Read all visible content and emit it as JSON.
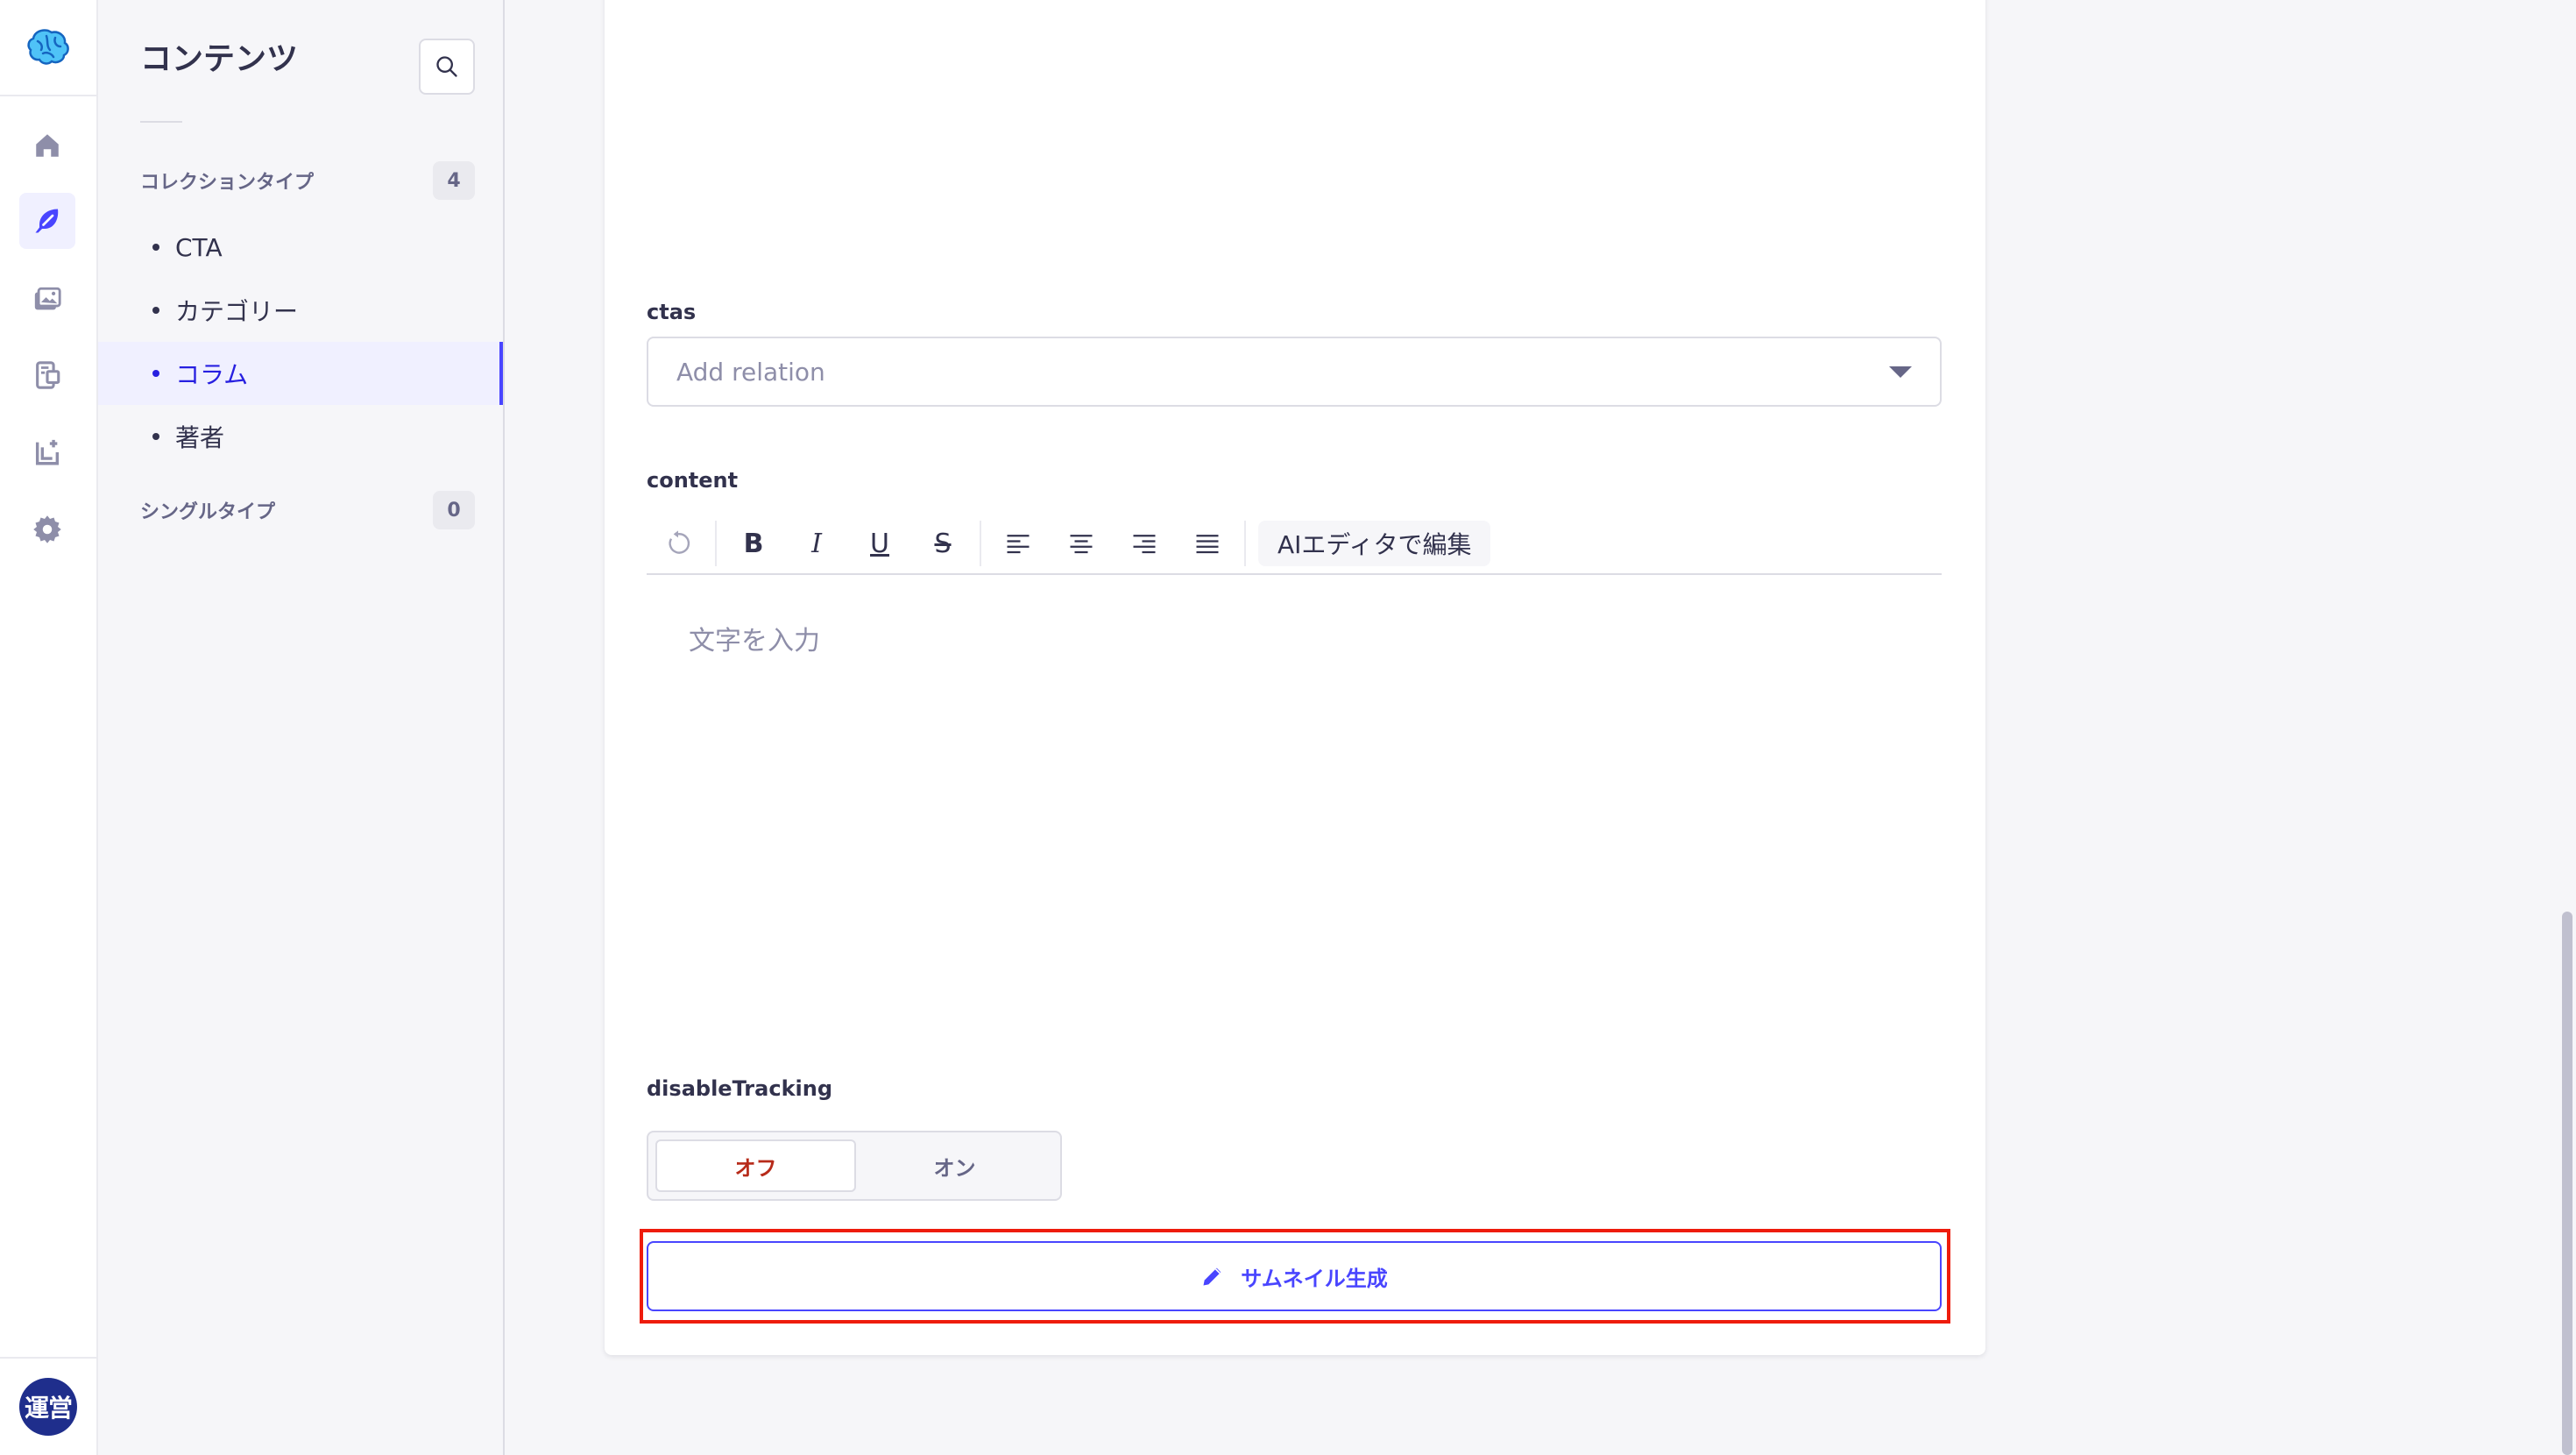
{
  "rail": {
    "logo_icon": "brain-logo-icon",
    "items": [
      {
        "name": "home",
        "icon": "home-icon",
        "active": false
      },
      {
        "name": "content-manager",
        "icon": "feather-icon",
        "active": true
      },
      {
        "name": "media-library",
        "icon": "images-icon",
        "active": false
      },
      {
        "name": "content-builder",
        "icon": "builder-icon",
        "active": false
      },
      {
        "name": "plugins",
        "icon": "puzzle-plus-icon",
        "active": false
      },
      {
        "name": "settings",
        "icon": "gear-icon",
        "active": false
      }
    ],
    "avatar_text": "運営"
  },
  "subnav": {
    "title": "コンテンツ",
    "search_icon": "search-icon",
    "collection_label": "コレクションタイプ",
    "collection_count": "4",
    "collection_items": [
      {
        "label": "CTA",
        "active": false
      },
      {
        "label": "カテゴリー",
        "active": false
      },
      {
        "label": "コラム",
        "active": true
      },
      {
        "label": "著者",
        "active": false
      }
    ],
    "single_label": "シングルタイプ",
    "single_count": "0"
  },
  "form": {
    "ctas_label": "ctas",
    "ctas_placeholder": "Add relation",
    "content_label": "content",
    "toolbar": {
      "undo_icon": "undo-icon",
      "bold": "B",
      "italic": "I",
      "underline": "U",
      "strike": "S",
      "align_left_icon": "align-left-icon",
      "align_center_icon": "align-center-icon",
      "align_right_icon": "align-right-icon",
      "align_justify_icon": "align-justify-icon",
      "ai_edit": "AIエディタで編集"
    },
    "editor_placeholder": "文字を入力",
    "disable_tracking_label": "disableTracking",
    "toggle_off": "オフ",
    "toggle_on": "オン",
    "toggle_selected": "off",
    "thumbnail_button": "サムネイル生成"
  },
  "colors": {
    "primary": "#4945ff",
    "highlight": "#ee1c0c",
    "danger_text": "#b72b1a",
    "avatar_bg": "#1f2e8c"
  }
}
